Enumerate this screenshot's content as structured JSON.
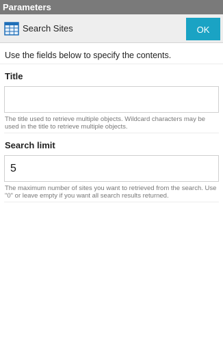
{
  "window": {
    "title": "Parameters"
  },
  "header": {
    "title": "Search Sites",
    "ok_label": "OK",
    "icon": "table-grid-icon"
  },
  "intro": "Use the fields below to specify the contents.",
  "fields": [
    {
      "label": "Title",
      "value": "",
      "help": "The title used to retrieve multiple objects. Wildcard characters may be used in the title to retrieve multiple objects."
    },
    {
      "label": "Search limit",
      "value": "5",
      "help": "The maximum number of sites you want to retrieved from the search. Use \"0\" or leave empty if you want all search results returned."
    }
  ],
  "colors": {
    "accent": "#1aa3c4",
    "titlebar": "#7a7a7a",
    "header_bg": "#eeeeee"
  }
}
